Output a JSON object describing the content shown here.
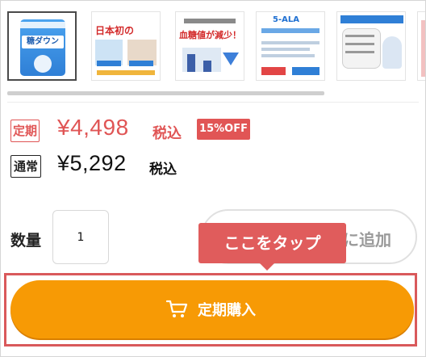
{
  "thumbnails": {
    "items": [
      {
        "title": "糖ダウン",
        "selected": true
      },
      {
        "title": "日本初の",
        "selected": false
      },
      {
        "title": "血糖値が減少！",
        "selected": false
      },
      {
        "title": "5-ALA",
        "selected": false
      },
      {
        "title": "こんな方におすすめ",
        "selected": false
      },
      {
        "title": "",
        "selected": false
      }
    ]
  },
  "prices": {
    "teiki_badge": "定期",
    "teiki_price": "¥4,498",
    "teiki_tax": "税込",
    "discount": "15%OFF",
    "tsujo_badge": "通常",
    "tsujo_price": "¥5,292",
    "tsujo_tax": "税込"
  },
  "quantity": {
    "label": "数量",
    "value": "1"
  },
  "cart_button": {
    "visible_text": "に追加"
  },
  "tooltip": {
    "text": "ここをタップ"
  },
  "buy_button": {
    "label": "定期購入",
    "icon": "cart-icon"
  },
  "colors": {
    "accent_red": "#e05555",
    "buy_orange": "#f79a05"
  }
}
